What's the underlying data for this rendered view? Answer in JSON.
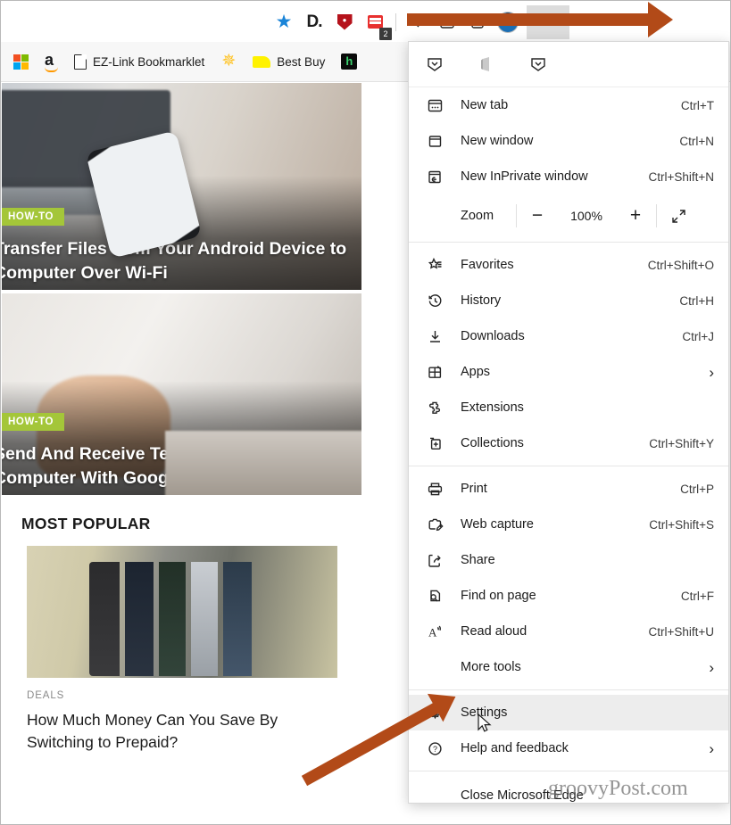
{
  "browser": {
    "toolbar": {
      "star_icon": "favorite-star-icon",
      "extensions": [
        {
          "name": "dashlane-extension-icon",
          "label": "D."
        },
        {
          "name": "lastpass-extension-icon",
          "label": ""
        },
        {
          "name": "grammarly-extension-icon",
          "label": "",
          "badge": "2"
        },
        {
          "name": "collections-extension-icon",
          "label": ""
        },
        {
          "name": "immersive-reader-icon",
          "label": ""
        },
        {
          "name": "add-collection-icon",
          "label": ""
        }
      ],
      "profile_label": "profile-avatar",
      "settings_more_label": "•••"
    },
    "bookmarks": [
      {
        "icon": "microsoft-icon",
        "label": ""
      },
      {
        "icon": "amazon-icon",
        "label": ""
      },
      {
        "icon": "page-icon",
        "label": "EZ-Link Bookmarklet"
      },
      {
        "icon": "walmart-icon",
        "label": ""
      },
      {
        "icon": "bestbuy-icon",
        "label": "Best Buy"
      },
      {
        "icon": "hulu-icon",
        "label": ""
      }
    ]
  },
  "page": {
    "articles": [
      {
        "tag": "HOW-TO",
        "title": "Transfer Files from Your Android Device to Computer Over Wi-Fi"
      },
      {
        "tag": "HOW-TO",
        "title": "Send And Receive Texts from Your Computer With Google Messages"
      }
    ],
    "most_popular": {
      "heading": "MOST POPULAR",
      "category": "DEALS",
      "title": "How Much Money Can You Save By Switching to Prepaid?"
    }
  },
  "menu": {
    "pinned_icons": [
      "lastpass-vault-icon",
      "office-icon",
      "lastpass-vault-icon"
    ],
    "items": [
      {
        "name": "new-tab",
        "icon": "new-tab-icon",
        "label": "New tab",
        "accel": "Ctrl+T",
        "submenu": false
      },
      {
        "name": "new-window",
        "icon": "new-window-icon",
        "label": "New window",
        "accel": "Ctrl+N",
        "submenu": false
      },
      {
        "name": "new-inprivate-window",
        "icon": "inprivate-icon",
        "label": "New InPrivate window",
        "accel": "Ctrl+Shift+N",
        "submenu": false
      }
    ],
    "zoom": {
      "label": "Zoom",
      "minus": "−",
      "value": "100%",
      "plus": "+",
      "fullscreen_icon": "fullscreen-icon"
    },
    "group2": [
      {
        "name": "favorites",
        "icon": "favorites-star-icon",
        "label": "Favorites",
        "accel": "Ctrl+Shift+O",
        "submenu": false
      },
      {
        "name": "history",
        "icon": "history-clock-icon",
        "label": "History",
        "accel": "Ctrl+H",
        "submenu": false
      },
      {
        "name": "downloads",
        "icon": "downloads-arrow-icon",
        "label": "Downloads",
        "accel": "Ctrl+J",
        "submenu": false
      },
      {
        "name": "apps",
        "icon": "apps-grid-icon",
        "label": "Apps",
        "accel": "",
        "submenu": true
      },
      {
        "name": "extensions",
        "icon": "extensions-puzzle-icon",
        "label": "Extensions",
        "accel": "",
        "submenu": false
      },
      {
        "name": "collections",
        "icon": "collections-plus-icon",
        "label": "Collections",
        "accel": "Ctrl+Shift+Y",
        "submenu": false
      }
    ],
    "group3": [
      {
        "name": "print",
        "icon": "printer-icon",
        "label": "Print",
        "accel": "Ctrl+P",
        "submenu": false
      },
      {
        "name": "web-capture",
        "icon": "web-capture-icon",
        "label": "Web capture",
        "accel": "Ctrl+Shift+S",
        "submenu": false
      },
      {
        "name": "share",
        "icon": "share-icon",
        "label": "Share",
        "accel": "",
        "submenu": false
      },
      {
        "name": "find-on-page",
        "icon": "find-magnifier-icon",
        "label": "Find on page",
        "accel": "Ctrl+F",
        "submenu": false
      },
      {
        "name": "read-aloud",
        "icon": "read-aloud-icon",
        "label": "Read aloud",
        "accel": "Ctrl+Shift+U",
        "submenu": false
      },
      {
        "name": "more-tools",
        "icon": "",
        "label": "More tools",
        "accel": "",
        "submenu": true
      }
    ],
    "group4": [
      {
        "name": "settings",
        "icon": "gear-icon",
        "label": "Settings",
        "accel": "",
        "submenu": false,
        "highlighted": true
      },
      {
        "name": "help-and-feedback",
        "icon": "help-question-icon",
        "label": "Help and feedback",
        "accel": "",
        "submenu": true
      }
    ],
    "close_label": "Close Microsoft Edge"
  },
  "annotations": {
    "watermark": "groovyPost.com",
    "arrow_color": "#b24a18"
  }
}
